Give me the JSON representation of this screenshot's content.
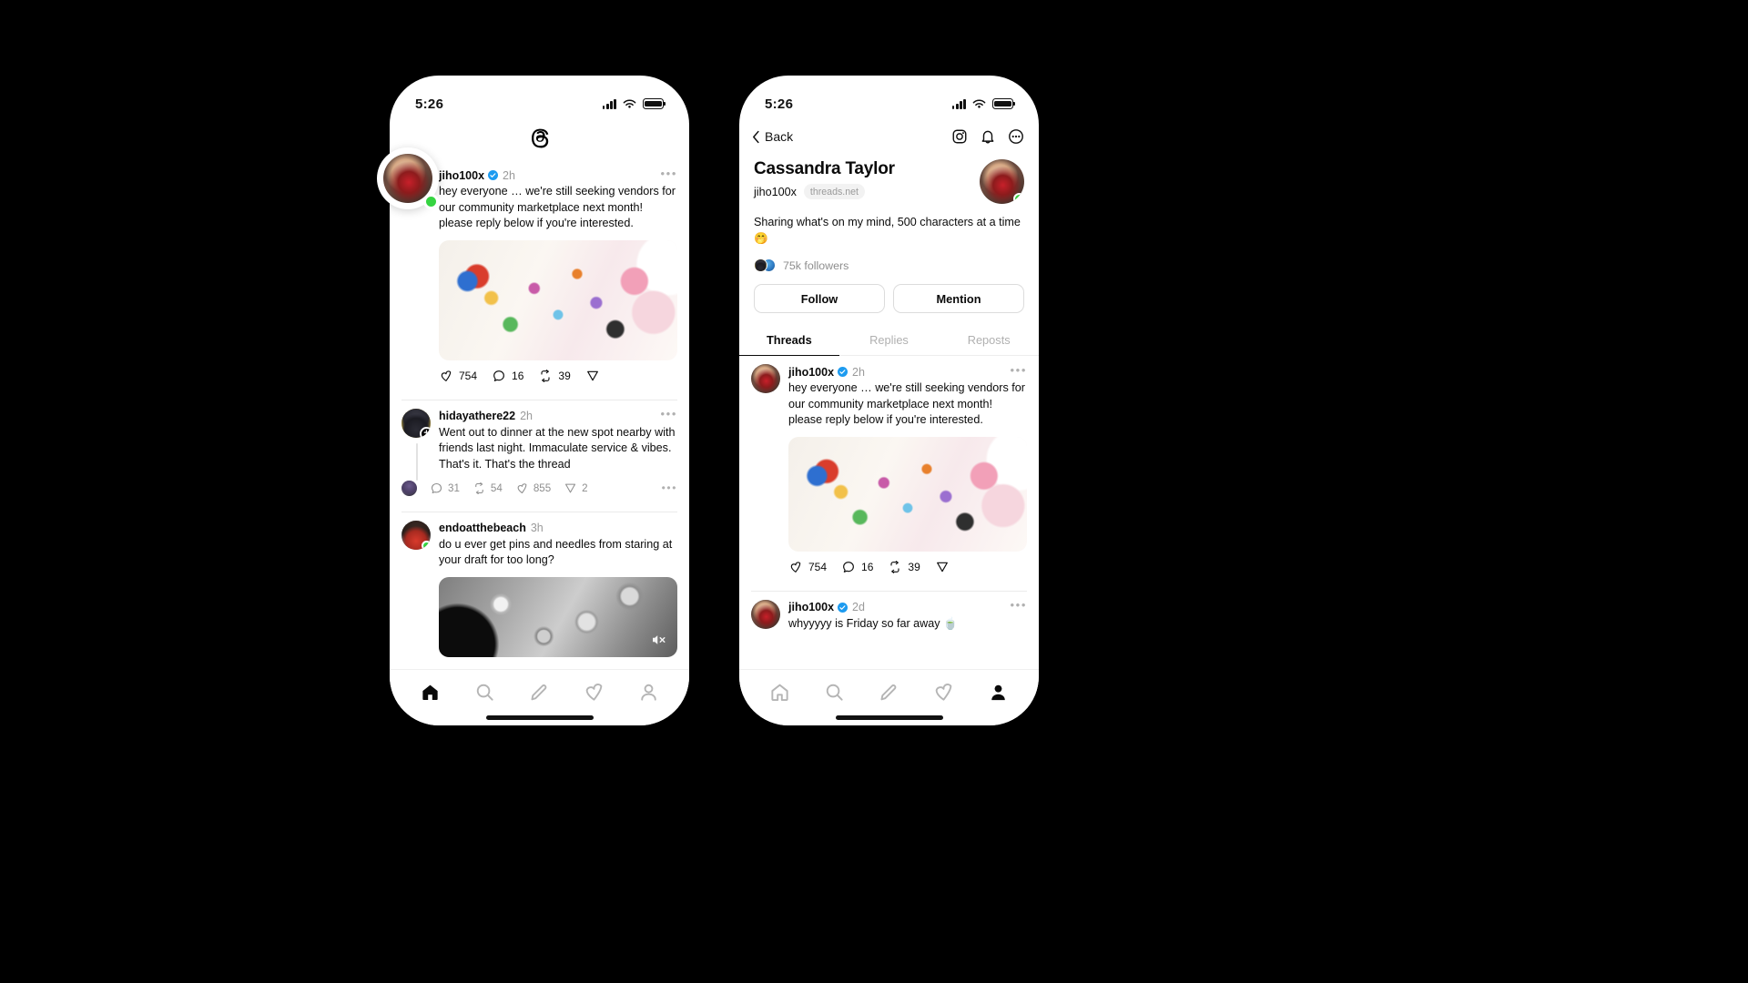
{
  "colors": {
    "background": "#000000",
    "phone_surface": "#ffffff",
    "text_primary": "#0a0a0a",
    "text_muted": "#8e8e8e",
    "verified_blue": "#1d9bf0",
    "online_green": "#35d441",
    "divider": "#ebebeb"
  },
  "left_phone": {
    "status": {
      "time": "5:26",
      "signal_icon": "cellular-bars-icon",
      "wifi_icon": "wifi-icon",
      "battery_icon": "battery-full-icon"
    },
    "header": {
      "logo_icon": "threads-logo-icon"
    },
    "zoom_callout": {
      "avatar_icon": "avatar-image",
      "online_icon": "online-status-dot"
    },
    "posts": [
      {
        "username": "jiho100x",
        "verified": true,
        "time": "2h",
        "more_icon": "more-options-icon",
        "text": "hey everyone … we're still seeking vendors for our community marketplace next month! please reply below if you're interested.",
        "media": "stickers-photo",
        "online": true,
        "actions": {
          "like_icon": "heart-icon",
          "likes": "754",
          "reply_icon": "comment-icon",
          "replies": "16",
          "repost_icon": "repost-icon",
          "reposts": "39",
          "share_icon": "share-icon"
        }
      },
      {
        "username": "hidayathere22",
        "verified": false,
        "time": "2h",
        "more_icon": "more-options-icon",
        "text": "Went out to dinner at the new spot nearby with friends last night. Immaculate service & vibes. That's it. That's the thread",
        "follow_badge_icon": "follow-plus-icon",
        "stats": {
          "reply_icon": "comment-icon",
          "replies": "31",
          "repost_icon": "repost-icon",
          "reposts": "54",
          "like_icon": "heart-icon",
          "likes": "855",
          "share_icon": "share-icon",
          "shares": "2",
          "more_icon": "more-options-icon"
        }
      },
      {
        "username": "endoatthebeach",
        "verified": false,
        "time": "3h",
        "text": "do u ever get pins and needles from staring at your draft for too long?",
        "media": "moon-photo",
        "media_mute_icon": "muted-audio-icon",
        "online": true
      }
    ],
    "tabbar": {
      "items": [
        {
          "icon": "home-icon",
          "label": "Home",
          "active": true
        },
        {
          "icon": "search-icon",
          "label": "Search",
          "active": false
        },
        {
          "icon": "compose-icon",
          "label": "Compose",
          "active": false
        },
        {
          "icon": "heart-icon",
          "label": "Activity",
          "active": false
        },
        {
          "icon": "person-icon",
          "label": "Profile",
          "active": false
        }
      ],
      "home_indicator_icon": "home-indicator"
    }
  },
  "right_phone": {
    "status": {
      "time": "5:26",
      "signal_icon": "cellular-bars-icon",
      "wifi_icon": "wifi-icon",
      "battery_icon": "battery-full-icon"
    },
    "header": {
      "back_label": "Back",
      "back_icon": "chevron-left-icon",
      "icons": [
        {
          "name": "instagram-icon"
        },
        {
          "name": "bell-icon"
        },
        {
          "name": "more-circle-icon"
        }
      ]
    },
    "profile": {
      "display_name": "Cassandra Taylor",
      "handle": "jiho100x",
      "domain_pill": "threads.net",
      "avatar_icon": "profile-avatar-image",
      "online_icon": "online-status-dot",
      "bio": "Sharing what's on my mind, 500 characters at a time 🤭",
      "followers_label": "75k followers",
      "follower_avatars_icon": "follower-avatar-stack",
      "buttons": [
        {
          "label": "Follow",
          "name": "follow-button"
        },
        {
          "label": "Mention",
          "name": "mention-button"
        }
      ]
    },
    "tabs": [
      {
        "label": "Threads",
        "active": true
      },
      {
        "label": "Replies",
        "active": false
      },
      {
        "label": "Reposts",
        "active": false
      }
    ],
    "posts": [
      {
        "username": "jiho100x",
        "verified": true,
        "time": "2h",
        "more_icon": "more-options-icon",
        "text": "hey everyone … we're still seeking vendors for our community marketplace next month! please reply below if you're interested.",
        "media": "stickers-photo",
        "actions": {
          "like_icon": "heart-icon",
          "likes": "754",
          "reply_icon": "comment-icon",
          "replies": "16",
          "repost_icon": "repost-icon",
          "reposts": "39",
          "share_icon": "share-icon"
        }
      },
      {
        "username": "jiho100x",
        "verified": true,
        "time": "2d",
        "more_icon": "more-options-icon",
        "text": "whyyyyy is Friday so far away 🍵"
      }
    ],
    "tabbar": {
      "items": [
        {
          "icon": "home-icon",
          "label": "Home",
          "active": false
        },
        {
          "icon": "search-icon",
          "label": "Search",
          "active": false
        },
        {
          "icon": "compose-icon",
          "label": "Compose",
          "active": false
        },
        {
          "icon": "heart-icon",
          "label": "Activity",
          "active": false
        },
        {
          "icon": "person-icon",
          "label": "Profile",
          "active": true
        }
      ],
      "home_indicator_icon": "home-indicator"
    }
  }
}
